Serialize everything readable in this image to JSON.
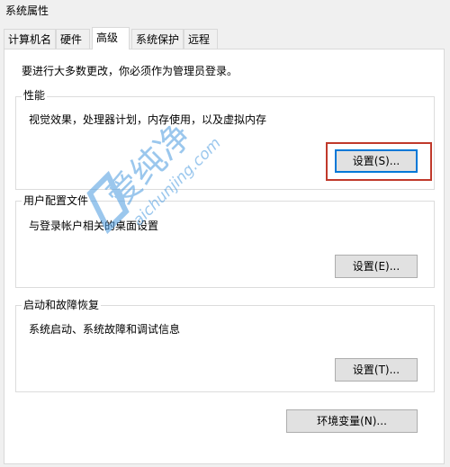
{
  "window": {
    "title": "系统属性"
  },
  "tabs": [
    {
      "label": "计算机名"
    },
    {
      "label": "硬件"
    },
    {
      "label": "高级"
    },
    {
      "label": "系统保护"
    },
    {
      "label": "远程"
    }
  ],
  "advanced": {
    "admin_note": "要进行大多数更改，你必须作为管理员登录。",
    "performance": {
      "title": "性能",
      "description": "视觉效果，处理器计划，内存使用，以及虚拟内存",
      "button": "设置(S)..."
    },
    "user_profiles": {
      "title": "用户配置文件",
      "description": "与登录帐户相关的桌面设置",
      "button": "设置(E)..."
    },
    "startup_recovery": {
      "title": "启动和故障恢复",
      "description": "系统启动、系统故障和调试信息",
      "button": "设置(T)..."
    },
    "env_button": "环境变量(N)..."
  },
  "watermark": {
    "cn": "爱纯净",
    "url": "aichunjing.com"
  },
  "colors": {
    "highlight": "#c0392b",
    "focus": "#0078d7",
    "watermark": "#4a9be0"
  }
}
